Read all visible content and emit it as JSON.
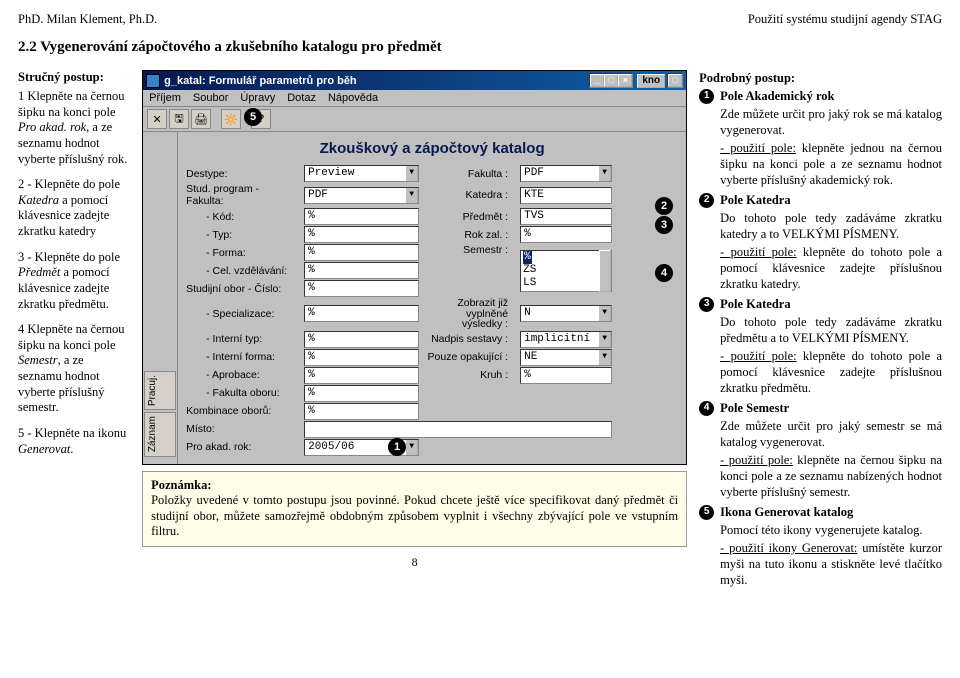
{
  "header": {
    "left": "PhD. Milan Klement, Ph.D.",
    "right": "Použití systému studijní agendy STAG"
  },
  "section_title": "2.2 Vygenerování zápočtového a zkušebního katalogu pro předmět",
  "left_col": {
    "heading": "Stručný postup:",
    "p1a": "1 Klepněte na černou šipku na konci pole ",
    "p1i": "Pro akad. rok",
    "p1b": ", a ze seznamu hodnot vyberte příslušný rok.",
    "p2a": "2 - Klepněte do pole ",
    "p2i": "Katedra",
    "p2b": " a pomocí klávesnice zadejte zkratku katedry",
    "p3a": "3 - Klepněte do pole ",
    "p3i": "Předmět",
    "p3b": " a pomocí klávesnice zadejte zkratku předmětu.",
    "p4a": "4 Klepněte na černou šipku na konci pole ",
    "p4i": "Semestr",
    "p4b": ", a ze seznamu hodnot vyberte příslušný semestr.",
    "p5a": "5 - Klepněte na ikonu ",
    "p5i": "Generovat",
    "p5b": "."
  },
  "window": {
    "title": "g_katal: Formulář parametrů pro běh",
    "right_pill": "kno",
    "menu": [
      "Příjem",
      "Soubor",
      "Úpravy",
      "Dotaz",
      "Nápověda"
    ],
    "form_title": "Zkouškový a zápočtový katalog",
    "vtab1": "Pracuj.",
    "vtab2": "Záznam",
    "labels": {
      "destype": "Destype:",
      "fakulta": "Fakulta :",
      "studprog": "Stud. program - Fakulta:",
      "katedra": "Katedra :",
      "kod": "- Kód:",
      "predmet": "Předmět :",
      "typ": "- Typ:",
      "rokzal": "Rok zal. :",
      "forma": "- Forma:",
      "semestr": "Semestr :",
      "celvzd": "- Cel. vzdělávání:",
      "zobrazit": "Zobrazit již vyplněné výsledky :",
      "studobor": "Studijní obor - Číslo:",
      "nadpis": "Nadpis sestavy :",
      "spec": "- Specializace:",
      "pouze": "Pouze opakující :",
      "intyp": "- Interní typ:",
      "inform": "- Interní forma:",
      "kruh": "Kruh :",
      "aprob": "- Aprobace:",
      "fakoboru": "- Fakulta oboru:",
      "komb": "Kombinace oborů:",
      "misto": "Místo:",
      "rok": "Pro akad. rok:"
    },
    "values": {
      "destype": "Preview",
      "fakulta": "PDF",
      "studprog": "PDF",
      "katedra": "KTE",
      "kod": "%",
      "predmet": "TVS",
      "typ": "%",
      "rokzal": "%",
      "forma": "%",
      "celvzd": "%",
      "sem_sel": "%",
      "sem_a": "ZS",
      "sem_b": "LS",
      "studobor": "%",
      "zobrazit": "N",
      "spec": "%",
      "nadpis": "implicitní",
      "intyp": "%",
      "pouze": "NE",
      "inform": "%",
      "kruh": "%",
      "aprob": "%",
      "fakoboru": "%",
      "komb": "%",
      "misto": "",
      "rok": "2005/06"
    }
  },
  "note": {
    "title": "Poznámka:",
    "body": "Položky uvedené v tomto postupu jsou povinné. Pokud chcete ještě více specifikovat daný předmět či studijní obor, můžete samozřejmě obdobným způsobem vyplnit i všechny zbývající pole ve vstupním filtru."
  },
  "right_col": {
    "heading": "Podrobný postup:",
    "s1t": "Pole Akademický rok",
    "s1a": "Zde můžete určit pro jaký rok se má katalog vygenerovat.",
    "s1b": "- použití pole:",
    "s1c": " klepněte jednou na černou šipku na konci pole a ze seznamu hodnot vyberte příslušný akademický rok.",
    "s2t": "Pole Katedra",
    "s2a": "Do tohoto pole tedy zadáváme zkratku katedry a to VELKÝMI PÍSMENY.",
    "s2b": "- použití pole:",
    "s2c": " klepněte do tohoto pole a pomocí klávesnice zadejte příslušnou zkratku katedry.",
    "s3t": "Pole Katedra",
    "s3a": "Do tohoto pole tedy zadáváme zkratku předmětu a to VELKÝMI PÍSMENY.",
    "s3b": "- použití pole:",
    "s3c": " klepněte do tohoto pole a pomocí klávesnice zadejte příslušnou zkratku předmětu.",
    "s4t": "Pole Semestr",
    "s4a": "Zde můžete určit pro jaký semestr se má katalog vygenerovat.",
    "s4b": "- použití pole:",
    "s4c": " klepněte na černou šipku na konci pole a ze seznamu nabízených hodnot vyberte příslušný semestr.",
    "s5t": "Ikona Generovat katalog",
    "s5a": "Pomocí této ikony vygenerujete katalog.",
    "s5b": "- použití ikony Generovat:",
    "s5c": " umístěte kurzor myši na tuto ikonu a stiskněte levé tlačítko myši."
  },
  "page_num": "8"
}
